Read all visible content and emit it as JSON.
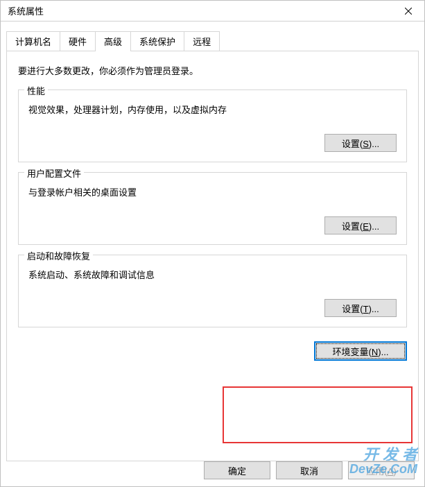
{
  "window": {
    "title": "系统属性"
  },
  "tabs": {
    "computer_name": "计算机名",
    "hardware": "硬件",
    "advanced": "高级",
    "system_protection": "系统保护",
    "remote": "远程"
  },
  "advanced": {
    "intro": "要进行大多数更改，你必须作为管理员登录。",
    "performance": {
      "legend": "性能",
      "desc": "视觉效果，处理器计划，内存使用，以及虚拟内存",
      "settings_btn": "设置(S)..."
    },
    "profiles": {
      "legend": "用户配置文件",
      "desc": "与登录帐户相关的桌面设置",
      "settings_btn": "设置(E)..."
    },
    "startup": {
      "legend": "启动和故障恢复",
      "desc": "系统启动、系统故障和调试信息",
      "settings_btn": "设置(T)..."
    },
    "env_btn": "环境变量(N)..."
  },
  "dialog_buttons": {
    "ok": "确定",
    "cancel": "取消",
    "apply": "应用(A)"
  },
  "watermark": {
    "line1": "开 发 者",
    "line2": "DevZe.CoM"
  }
}
